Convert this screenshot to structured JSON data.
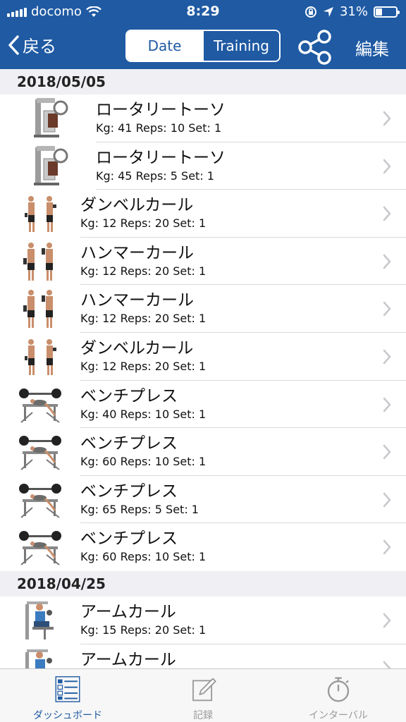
{
  "status_bar": {
    "carrier": "docomo",
    "time": "8:29",
    "battery_percent": "31%",
    "battery_level": 0.31
  },
  "nav": {
    "back_label": "戻る",
    "segments": [
      {
        "label": "Date",
        "selected": true
      },
      {
        "label": "Training",
        "selected": false
      }
    ],
    "share_icon": "share-icon",
    "edit_label": "編集"
  },
  "sections": [
    {
      "date": "2018/05/05",
      "entries": [
        {
          "name": "ロータリートーソ",
          "detail": "Kg: 41 Reps: 10 Set: 1",
          "thumb": "machine"
        },
        {
          "name": "ロータリートーソ",
          "detail": "Kg: 45 Reps: 5 Set: 1",
          "thumb": "machine"
        },
        {
          "name": "ダンベルカール",
          "detail": "Kg: 12 Reps: 20 Set: 1",
          "thumb": "curl"
        },
        {
          "name": "ハンマーカール",
          "detail": "Kg: 12 Reps: 20 Set: 1",
          "thumb": "hammer"
        },
        {
          "name": "ハンマーカール",
          "detail": "Kg: 12 Reps: 20 Set: 1",
          "thumb": "hammer"
        },
        {
          "name": "ダンベルカール",
          "detail": "Kg: 12 Reps: 20 Set: 1",
          "thumb": "curl"
        },
        {
          "name": "ベンチプレス",
          "detail": "Kg: 40 Reps: 10 Set: 1",
          "thumb": "bench"
        },
        {
          "name": "ベンチプレス",
          "detail": "Kg: 60 Reps: 10 Set: 1",
          "thumb": "bench"
        },
        {
          "name": "ベンチプレス",
          "detail": "Kg: 65 Reps: 5 Set: 1",
          "thumb": "bench"
        },
        {
          "name": "ベンチプレス",
          "detail": "Kg: 60 Reps: 10 Set: 1",
          "thumb": "bench"
        }
      ]
    },
    {
      "date": "2018/04/25",
      "entries": [
        {
          "name": "アームカール",
          "detail": "Kg: 15 Reps: 20 Set: 1",
          "thumb": "armcurl"
        },
        {
          "name": "アームカール",
          "detail": "",
          "thumb": "armcurl"
        }
      ]
    }
  ],
  "tabs": [
    {
      "label": "ダッシュボード",
      "icon": "dashboard-icon",
      "active": true
    },
    {
      "label": "記録",
      "icon": "pencil-icon",
      "active": false
    },
    {
      "label": "インターバル",
      "icon": "stopwatch-icon",
      "active": false
    }
  ],
  "colors": {
    "brand": "#1f5aa3",
    "section_bg": "#efeff4",
    "chevron": "#c7c7cc",
    "inactive_tab": "#9a9a9a"
  }
}
